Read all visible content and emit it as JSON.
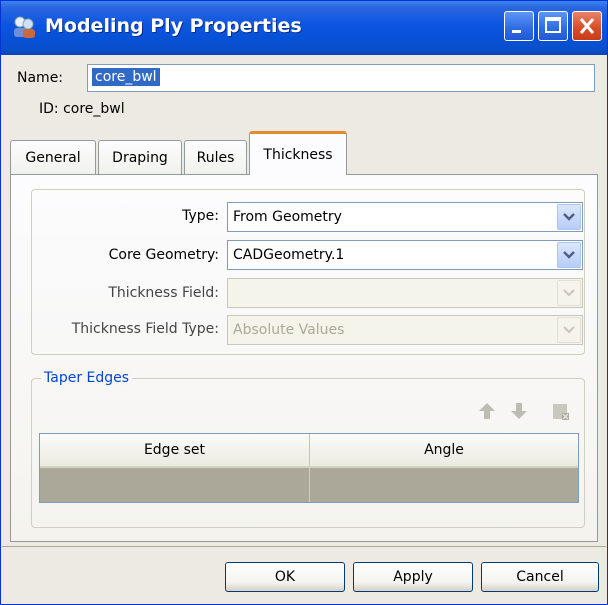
{
  "window": {
    "title": "Modeling Ply Properties",
    "accent_color": "#0851d6",
    "icons": [
      "ply-properties-icon",
      "minimize-icon",
      "maximize-icon",
      "close-icon"
    ]
  },
  "header": {
    "name_label": "Name:",
    "name_value": "core_bwl",
    "id_text": "ID: core_bwl"
  },
  "tabs": [
    {
      "label": "General",
      "active": false
    },
    {
      "label": "Draping",
      "active": false
    },
    {
      "label": "Rules",
      "active": false
    },
    {
      "label": "Thickness",
      "active": true
    }
  ],
  "thickness": {
    "type_label": "Type:",
    "type_value": "From Geometry",
    "core_geometry_label": "Core Geometry:",
    "core_geometry_value": "CADGeometry.1",
    "thickness_field_label": "Thickness Field:",
    "thickness_field_value": "",
    "thickness_field_type_label": "Thickness Field Type:",
    "thickness_field_type_value": "Absolute Values"
  },
  "taper_edges": {
    "title": "Taper Edges",
    "toolbar_icons": [
      "move-up-icon",
      "move-down-icon",
      "delete-row-icon"
    ],
    "columns": [
      "Edge set",
      "Angle"
    ],
    "rows": [
      [
        "",
        ""
      ]
    ]
  },
  "buttons": {
    "ok": "OK",
    "apply": "Apply",
    "cancel": "Cancel"
  }
}
